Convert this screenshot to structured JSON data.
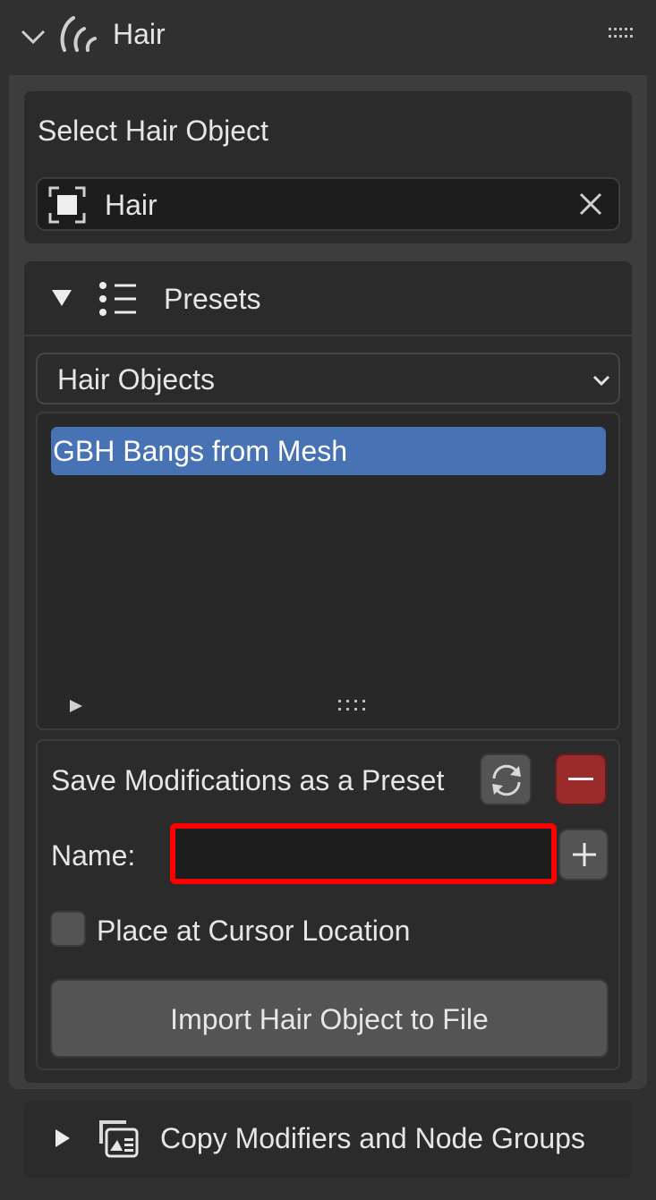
{
  "header": {
    "title": "Hair",
    "icon": "hair-icon"
  },
  "select_hair": {
    "title": "Select Hair Object",
    "field_value": "Hair"
  },
  "presets": {
    "title": "Presets",
    "category_selected": "Hair Objects",
    "list_items": [
      {
        "label": "GBH Bangs from Mesh",
        "selected": true
      }
    ],
    "grip_label": "::::"
  },
  "save_section": {
    "title": "Save Modifications as a Preset",
    "name_label": "Name:",
    "name_value": "",
    "checkbox_label": "Place at Cursor Location",
    "checkbox_checked": false,
    "import_button": "Import Hair Object to File"
  },
  "copy_section": {
    "title": "Copy Modifiers and Node Groups"
  },
  "colors": {
    "selection": "#4772b3",
    "remove_button": "#9b2a2a",
    "highlight_outline": "#ff0000"
  }
}
